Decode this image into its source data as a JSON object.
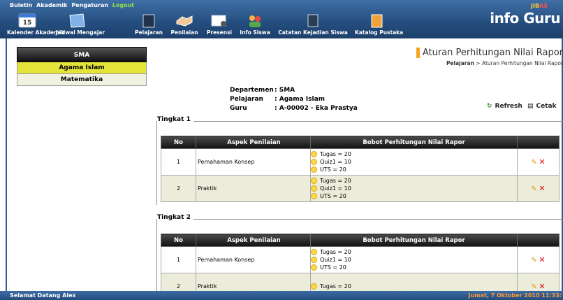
{
  "top_menu": {
    "items": [
      "Buletin",
      "Akademik",
      "Pengaturan"
    ],
    "logout": "Logout"
  },
  "nav": [
    {
      "label": "Kalender Akademik",
      "icon": "calendar-icon"
    },
    {
      "label": "Jadwal Mengajar",
      "icon": "schedule-icon"
    },
    {
      "label": "Pelajaran",
      "icon": "book-icon"
    },
    {
      "label": "Penilaian",
      "icon": "handshake-icon"
    },
    {
      "label": "Presensi",
      "icon": "attendance-icon"
    },
    {
      "label": "Info Siswa",
      "icon": "students-icon"
    },
    {
      "label": "Catatan Kejadian Siswa",
      "icon": "notes-icon"
    },
    {
      "label": "Katalog Pustaka",
      "icon": "library-icon"
    }
  ],
  "calendar_day": "15",
  "brand": {
    "small_prefix": "JIB",
    "small_suffix": "AS",
    "name": "info Guru"
  },
  "sidebar": {
    "header": "SMA",
    "items": [
      {
        "label": "Agama Islam",
        "active": true
      },
      {
        "label": "Matematika",
        "active": false
      }
    ]
  },
  "page": {
    "title": "Aturan Perhitungan Nilai Rapor",
    "breadcrumb_parent": "Pelajaran",
    "breadcrumb_sep": ">",
    "breadcrumb_current": "Aturan Perhitungan Nilai Rapor"
  },
  "info": {
    "departemen_label": "Departemen",
    "departemen_value": ": SMA",
    "pelajaran_label": "Pelajaran",
    "pelajaran_value": ": Agama Islam",
    "guru_label": "Guru",
    "guru_value": ": A-00002 - Eka Prastya"
  },
  "tools": {
    "refresh": "Refresh",
    "cetak": "Cetak"
  },
  "table_headers": {
    "no": "No",
    "aspek": "Aspek Penilaian",
    "bobot": "Bobot Perhitungan Nilai Rapor"
  },
  "tingkat": [
    {
      "label": "Tingkat 1",
      "rows": [
        {
          "no": "1",
          "aspek": "Pemahaman Konsep",
          "bobot": [
            "Tugas = 20",
            "Quiz1 = 10",
            "UTS = 20"
          ]
        },
        {
          "no": "2",
          "aspek": "Praktik",
          "bobot": [
            "Tugas = 20",
            "Quiz1 = 10",
            "UTS = 20"
          ]
        }
      ]
    },
    {
      "label": "Tingkat 2",
      "rows": [
        {
          "no": "1",
          "aspek": "Pemahaman Konsep",
          "bobot": [
            "Tugas = 20",
            "Quiz1 = 10",
            "UTS = 20"
          ]
        },
        {
          "no": "2",
          "aspek": "Praktik",
          "bobot": [
            "Tugas = 20",
            "",
            ""
          ]
        }
      ]
    }
  ],
  "status": {
    "left": "Selamat Datang Alex",
    "right": "Jumat, 7 Oktober 2010 11:33:"
  }
}
